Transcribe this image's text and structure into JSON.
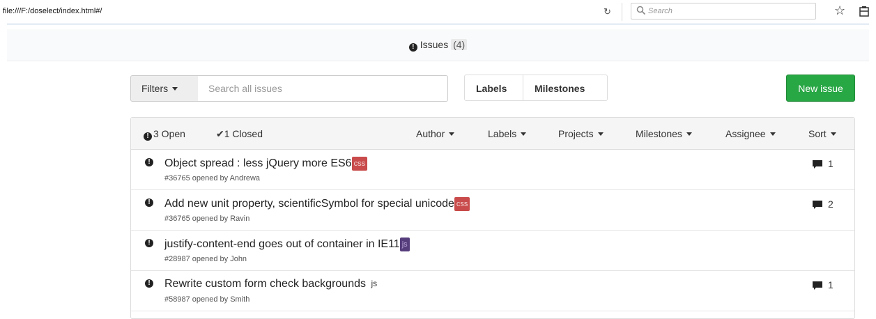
{
  "browser": {
    "url": "file:///F:/doselect/index.html#/",
    "search_placeholder": "Search"
  },
  "header": {
    "title": "Issues",
    "count": "(4)"
  },
  "toolbar": {
    "filters_label": "Filters",
    "search_placeholder": "Search all issues",
    "labels_label": "Labels",
    "milestones_label": "Milestones",
    "new_issue_label": "New issue"
  },
  "list_header": {
    "open_label": "3 Open",
    "closed_label": "1  Closed",
    "dropdowns": [
      "Author",
      "Labels",
      "Projects",
      "Milestones",
      "Assignee",
      "Sort"
    ]
  },
  "issues": [
    {
      "title": "Object spread : less jQuery more ES6",
      "label": "css",
      "meta": "#36765 opened by Andrewa",
      "comments": "1"
    },
    {
      "title": "Add new unit property, scientificSymbol for special unicode",
      "label": "css",
      "meta": "#36765 opened by Ravin",
      "comments": "2"
    },
    {
      "title": "justify-content-end goes out of container in IE11",
      "label": "js",
      "meta": "#28987 opened by John",
      "comments": ""
    },
    {
      "title": "Rewrite custom form check backgrounds ",
      "label": "js",
      "meta": "#58987 opened by Smith",
      "comments": "1"
    }
  ],
  "colors": {
    "new_issue_bg": "#28a745",
    "css_label_bg": "#c94b4b",
    "js_label_bg": "#563d7c"
  }
}
